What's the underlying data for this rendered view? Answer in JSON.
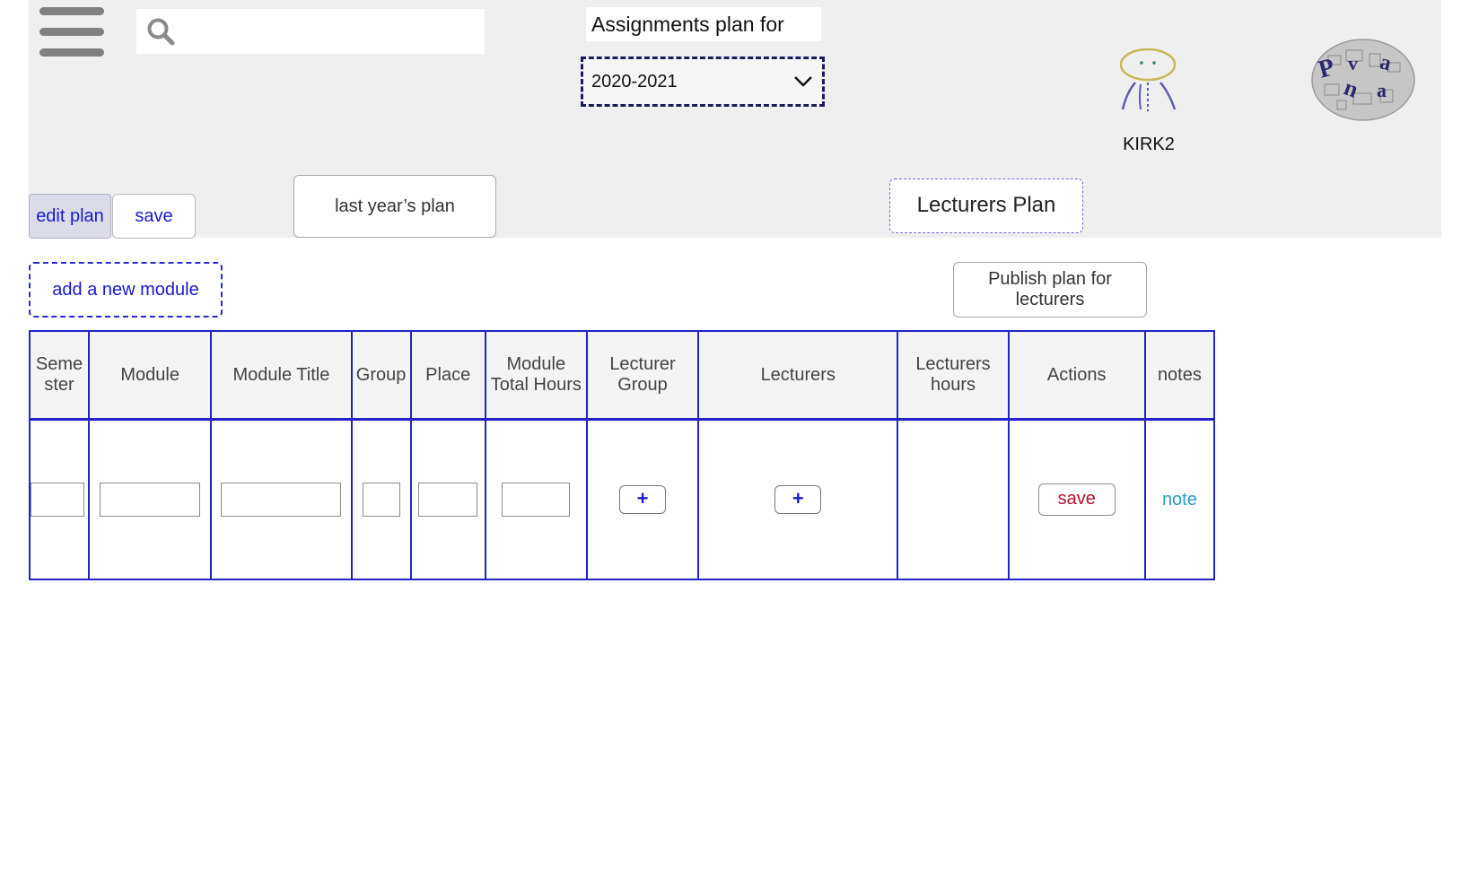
{
  "header": {
    "search": {
      "placeholder": "",
      "value": ""
    },
    "plan_title": "Assignments plan for",
    "year_select": {
      "selected": "2020-2021"
    },
    "user": {
      "name": "KIRK2"
    }
  },
  "toolbar": {
    "edit_plan_label": "edit  plan",
    "save_label": "save",
    "last_year_label": "last year’s plan",
    "lecturers_plan_label": "Lecturers Plan"
  },
  "actions": {
    "add_module_label": "add a new module",
    "publish_label_line1": "Publish plan for",
    "publish_label_line2": "lecturers"
  },
  "table": {
    "columns": [
      {
        "line1": "Seme",
        "line2": "ster"
      },
      {
        "line1": "Module",
        "line2": ""
      },
      {
        "line1": "Module Title",
        "line2": ""
      },
      {
        "line1": "Group",
        "line2": ""
      },
      {
        "line1": "Place",
        "line2": ""
      },
      {
        "line1": "Module",
        "line2": "Total Hours"
      },
      {
        "line1": "Lecturer",
        "line2": "Group"
      },
      {
        "line1": "Lecturers",
        "line2": ""
      },
      {
        "line1": "Lecturers",
        "line2": "hours"
      },
      {
        "line1": "Actions",
        "line2": ""
      },
      {
        "line1": "notes",
        "line2": ""
      }
    ],
    "row": {
      "plus_symbol": "+",
      "save_label": "save",
      "note_label": "note"
    }
  },
  "colors": {
    "accent_blue": "#2323c8",
    "link_blue": "#1a1acc",
    "save_red": "#b0142c",
    "note_cyan": "#2a9bc4",
    "header_bg": "#efefef"
  },
  "icons": [
    "menu-icon",
    "search-icon",
    "chevron-down-icon",
    "avatar-icon",
    "logo-icon",
    "plus-icon"
  ]
}
